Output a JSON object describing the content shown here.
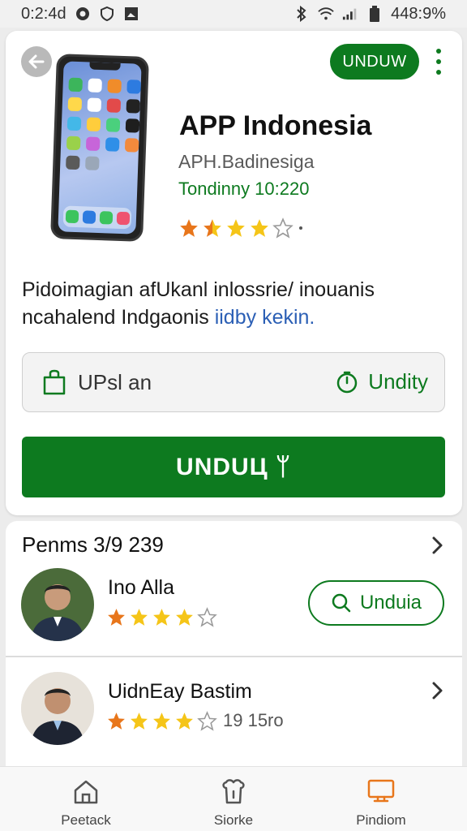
{
  "status_bar": {
    "time": "0:2:4d",
    "battery": "448:9%"
  },
  "app": {
    "title": "APP Indonesia",
    "developer": "APH.Badinesiga",
    "updated": "Tondinny 10:220",
    "rating": 3.5,
    "install_pill_label": "UNDUW",
    "description_main": "Pidoimagian afUkanl inlossrie/ inouanis ncahalend Indgaonis ",
    "description_link": "iidby kekin.",
    "option_left_label": "UPsl an",
    "option_right_label": "Undity",
    "download_button_label": "UNDUЦ ᛘ"
  },
  "reviews": {
    "header": "Penms 3/9 239",
    "items": [
      {
        "name": "Ino Alla",
        "rating": 4,
        "action_label": "Unduia"
      },
      {
        "name": "UidnEay Bastim",
        "rating": 4,
        "count": "19 15ro"
      }
    ]
  },
  "bottom_nav": {
    "items": [
      {
        "label": "Peetack",
        "icon": "home-icon"
      },
      {
        "label": "Siorke",
        "icon": "store-icon"
      },
      {
        "label": "Pindiom",
        "icon": "device-icon"
      }
    ]
  },
  "colors": {
    "accent_green": "#0d7a1f",
    "star_gold": "#f5c518",
    "star_orange": "#e8761b",
    "link_blue": "#2b5fb5"
  }
}
